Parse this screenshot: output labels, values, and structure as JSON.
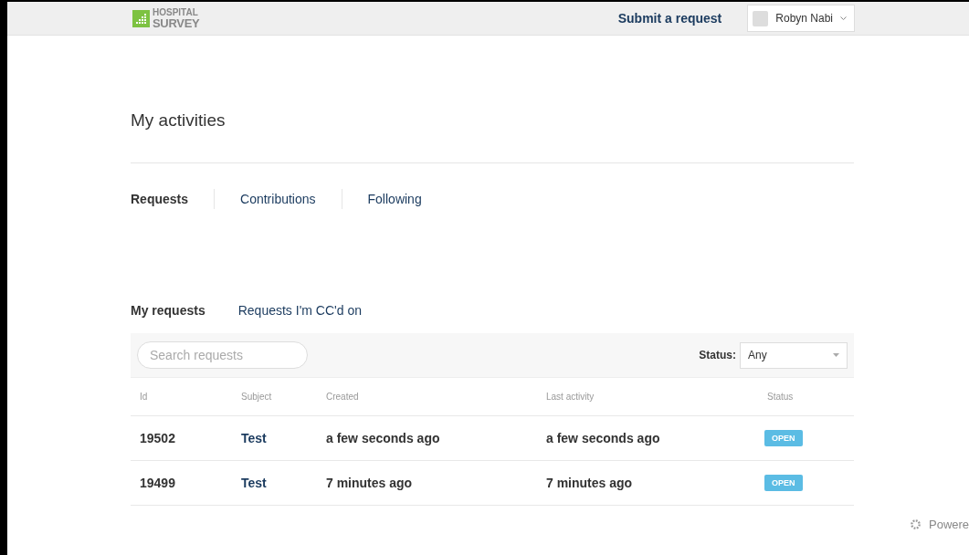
{
  "header": {
    "logo": [
      "HOSPITAL",
      "SURVEY"
    ],
    "submit_link": "Submit a request",
    "user": {
      "name": "Robyn Nabi"
    }
  },
  "page_title": "My activities",
  "activity_tabs": [
    {
      "label": "Requests",
      "selected": true
    },
    {
      "label": "Contributions",
      "selected": false
    },
    {
      "label": "Following",
      "selected": false
    }
  ],
  "request_tabs": [
    {
      "label": "My requests",
      "selected": true
    },
    {
      "label": "Requests I'm CC'd on",
      "selected": false
    }
  ],
  "search": {
    "placeholder": "Search requests"
  },
  "status_filter": {
    "label": "Status:",
    "value": "Any"
  },
  "table": {
    "columns": [
      "Id",
      "Subject",
      "Created",
      "Last activity",
      "Status"
    ],
    "rows": [
      {
        "id": "19502",
        "subject": "Test",
        "created": "a few seconds ago",
        "last_activity": "a few seconds ago",
        "status": "OPEN"
      },
      {
        "id": "19499",
        "subject": "Test",
        "created": "7 minutes ago",
        "last_activity": "7 minutes ago",
        "status": "OPEN"
      }
    ]
  },
  "footer": {
    "powered": "Powere"
  }
}
